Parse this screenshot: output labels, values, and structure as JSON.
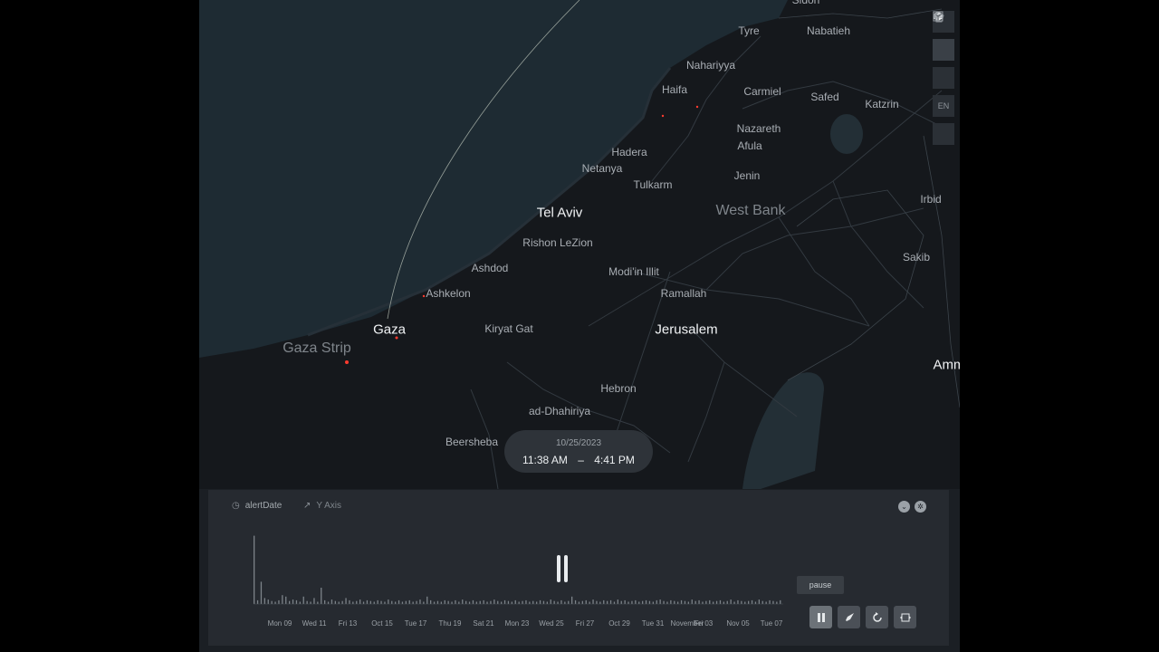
{
  "map": {
    "cities": [
      {
        "name": "Sidon",
        "type": "minor"
      },
      {
        "name": "Tyre",
        "type": "minor"
      },
      {
        "name": "Nabatieh",
        "type": "minor"
      },
      {
        "name": "Nahariyya",
        "type": "minor"
      },
      {
        "name": "Haifa",
        "type": "minor"
      },
      {
        "name": "Carmiel",
        "type": "minor"
      },
      {
        "name": "Safed",
        "type": "minor"
      },
      {
        "name": "Katzrin",
        "type": "minor"
      },
      {
        "name": "Nazareth",
        "type": "minor"
      },
      {
        "name": "Afula",
        "type": "minor"
      },
      {
        "name": "Hadera",
        "type": "minor"
      },
      {
        "name": "Netanya",
        "type": "minor"
      },
      {
        "name": "Jenin",
        "type": "minor"
      },
      {
        "name": "Tulkarm",
        "type": "minor"
      },
      {
        "name": "Irbid",
        "type": "minor"
      },
      {
        "name": "Tel Aviv",
        "type": "major"
      },
      {
        "name": "West Bank",
        "type": "region"
      },
      {
        "name": "Rishon LeZion",
        "type": "minor"
      },
      {
        "name": "Sakib",
        "type": "minor"
      },
      {
        "name": "Ashdod",
        "type": "minor"
      },
      {
        "name": "Modi'in Illit",
        "type": "minor"
      },
      {
        "name": "Ashkelon",
        "type": "minor"
      },
      {
        "name": "Ramallah",
        "type": "minor"
      },
      {
        "name": "Gaza",
        "type": "major"
      },
      {
        "name": "Kiryat Gat",
        "type": "minor"
      },
      {
        "name": "Jerusalem",
        "type": "major"
      },
      {
        "name": "Gaza Strip",
        "type": "region"
      },
      {
        "name": "Amm",
        "type": "major"
      },
      {
        "name": "Hebron",
        "type": "minor"
      },
      {
        "name": "ad-Dhahiriya",
        "type": "minor"
      },
      {
        "name": "Beersheba",
        "type": "minor"
      }
    ],
    "colors": {
      "sea": "#1e2b33",
      "land": "#15181c",
      "roads": "#3a4148",
      "alert": "#ff3b2f"
    }
  },
  "toolbar": {
    "items": [
      {
        "icon": "split-map-icon"
      },
      {
        "icon": "3d-cube-icon",
        "active": true
      },
      {
        "icon": "draw-polygon-icon"
      },
      {
        "icon": "language-icon",
        "label": "EN"
      },
      {
        "icon": "map-legend-icon"
      }
    ]
  },
  "time_window": {
    "date": "10/25/2023",
    "start": "11:38 AM",
    "separator": "–",
    "end": "4:41 PM"
  },
  "timeline": {
    "field_label": "alertDate",
    "y_axis_label": "Y Axis",
    "tooltip": "pause",
    "tick_labels": [
      "Mon 09",
      "Wed 11",
      "Fri 13",
      "Oct 15",
      "Tue 17",
      "Thu 19",
      "Sat 21",
      "Mon 23",
      "Wed 25",
      "Fri 27",
      "Oct 29",
      "Tue 31",
      "November",
      "Fri 03",
      "Nov 05",
      "Tue 07"
    ],
    "histogram_heights": [
      0.92,
      0.05,
      0.3,
      0.08,
      0.06,
      0.04,
      0.03,
      0.05,
      0.12,
      0.1,
      0.04,
      0.06,
      0.05,
      0.03,
      0.1,
      0.04,
      0.03,
      0.08,
      0.03,
      0.22,
      0.05,
      0.03,
      0.06,
      0.04,
      0.03,
      0.04,
      0.08,
      0.05,
      0.03,
      0.04,
      0.06,
      0.03,
      0.05,
      0.04,
      0.03,
      0.05,
      0.04,
      0.03,
      0.06,
      0.04,
      0.03,
      0.05,
      0.03,
      0.04,
      0.05,
      0.03,
      0.04,
      0.06,
      0.03,
      0.1,
      0.05,
      0.03,
      0.04,
      0.03,
      0.05,
      0.04,
      0.03,
      0.05,
      0.03,
      0.06,
      0.04,
      0.03,
      0.05,
      0.03,
      0.04,
      0.05,
      0.03,
      0.04,
      0.06,
      0.04,
      0.03,
      0.05,
      0.04,
      0.03,
      0.05,
      0.03,
      0.04,
      0.05,
      0.03,
      0.04,
      0.03,
      0.05,
      0.04,
      0.03,
      0.06,
      0.04,
      0.03,
      0.05,
      0.03,
      0.04,
      0.1,
      0.05,
      0.03,
      0.04,
      0.05,
      0.03,
      0.06,
      0.04,
      0.03,
      0.05,
      0.04,
      0.05,
      0.03,
      0.06,
      0.04,
      0.05,
      0.03,
      0.04,
      0.05,
      0.03,
      0.04,
      0.05,
      0.04,
      0.03,
      0.05,
      0.06,
      0.04,
      0.03,
      0.05,
      0.04,
      0.03,
      0.05,
      0.04,
      0.03,
      0.06,
      0.04,
      0.05,
      0.03,
      0.04,
      0.05,
      0.03,
      0.04,
      0.05,
      0.03,
      0.04,
      0.06,
      0.03,
      0.05,
      0.04,
      0.03,
      0.04,
      0.05,
      0.03,
      0.06,
      0.04,
      0.03,
      0.05,
      0.04,
      0.03,
      0.05
    ]
  },
  "controls": [
    {
      "name": "pause-button",
      "icon": "pause-icon",
      "active": true
    },
    {
      "name": "speed-button",
      "icon": "rocket-icon"
    },
    {
      "name": "reset-button",
      "icon": "reset-icon"
    },
    {
      "name": "window-button",
      "icon": "time-window-icon"
    }
  ]
}
